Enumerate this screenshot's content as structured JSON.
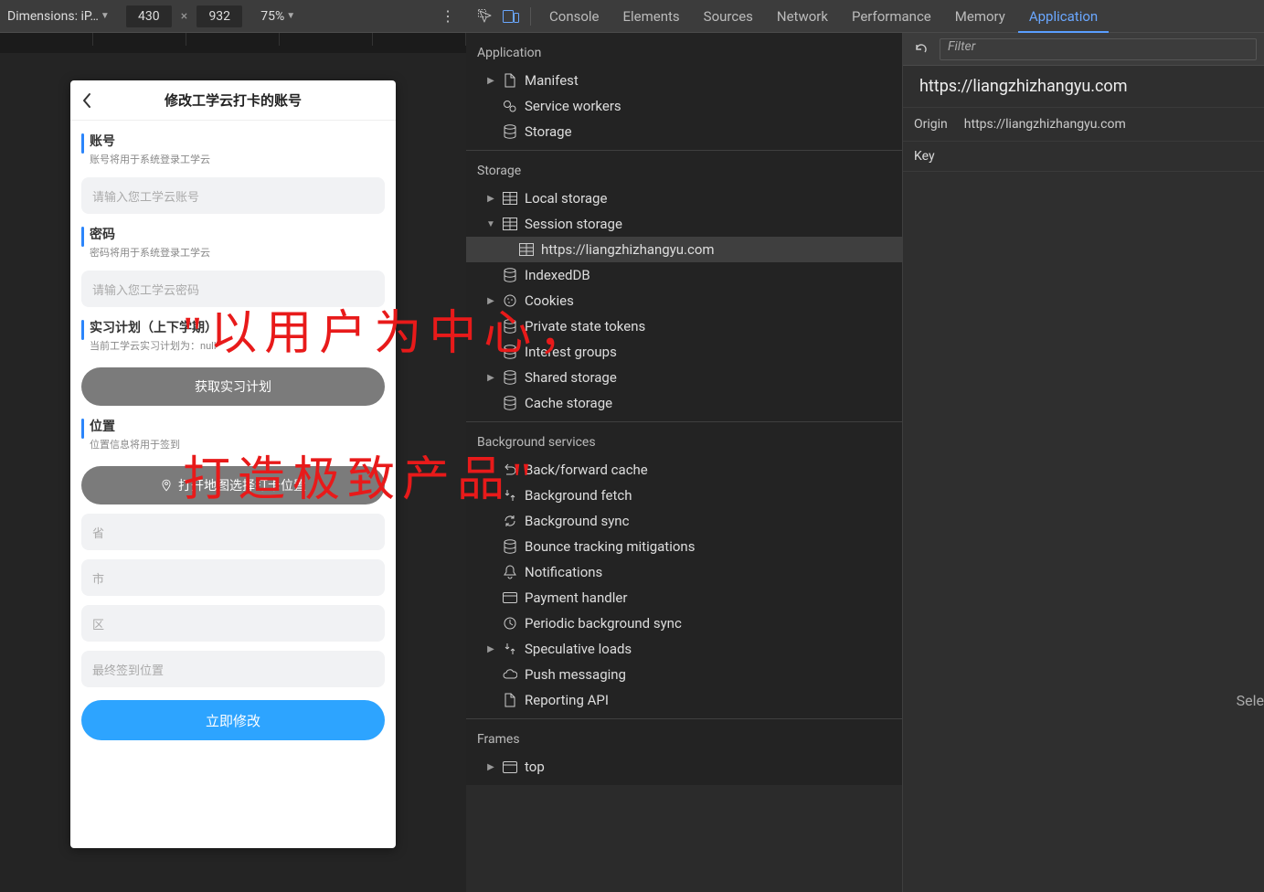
{
  "deviceToolbar": {
    "dimensionsLabel": "Dimensions: iP…",
    "width": "430",
    "height": "932",
    "zoom": "75%"
  },
  "phone": {
    "title": "修改工学云打卡的账号",
    "account": {
      "label": "账号",
      "sub": "账号将用于系统登录工学云",
      "placeholder": "请输入您工学云账号"
    },
    "password": {
      "label": "密码",
      "sub": "密码将用于系统登录工学云",
      "placeholder": "请输入您工学云密码"
    },
    "plan": {
      "label": "实习计划（上下学期）",
      "sub": "当前工学云实习计划为：null"
    },
    "getPlanButton": "获取实习计划",
    "position": {
      "label": "位置",
      "sub": "位置信息将用于签到"
    },
    "mapButton": "打开地图选择打卡位置",
    "addressFields": {
      "province": "省",
      "city": "市",
      "district": "区",
      "finalLocation": "最终签到位置"
    },
    "submitButton": "立即修改"
  },
  "overlay": {
    "line1": "\"以用户为中心，",
    "line2": "打造极致产品\""
  },
  "devtools": {
    "tabs": {
      "console": "Console",
      "elements": "Elements",
      "sources": "Sources",
      "network": "Network",
      "performance": "Performance",
      "memory": "Memory",
      "application": "Application"
    },
    "sections": {
      "application": {
        "header": "Application",
        "manifest": "Manifest",
        "serviceWorkers": "Service workers",
        "storage": "Storage"
      },
      "storage": {
        "header": "Storage",
        "localStorage": "Local storage",
        "sessionStorage": "Session storage",
        "sessionHost": "https://liangzhizhangyu.com",
        "indexedDB": "IndexedDB",
        "cookies": "Cookies",
        "privateTokens": "Private state tokens",
        "interestGroups": "Interest groups",
        "sharedStorage": "Shared storage",
        "cacheStorage": "Cache storage"
      },
      "backgroundServices": {
        "header": "Background services",
        "backForwardCache": "Back/forward cache",
        "backgroundFetch": "Background fetch",
        "backgroundSync": "Background sync",
        "bounceMitigations": "Bounce tracking mitigations",
        "notifications": "Notifications",
        "paymentHandler": "Payment handler",
        "periodicSync": "Periodic background sync",
        "speculativeLoads": "Speculative loads",
        "pushMessaging": "Push messaging",
        "reportingApi": "Reporting API"
      },
      "frames": {
        "header": "Frames",
        "top": "top"
      }
    },
    "detail": {
      "filterPlaceholder": "Filter",
      "pageUrl": "https://liangzhizhangyu.com",
      "originLabel": "Origin",
      "originValue": "https://liangzhizhangyu.com",
      "keyHeader": "Key",
      "selectedLabel": "Sele"
    }
  }
}
